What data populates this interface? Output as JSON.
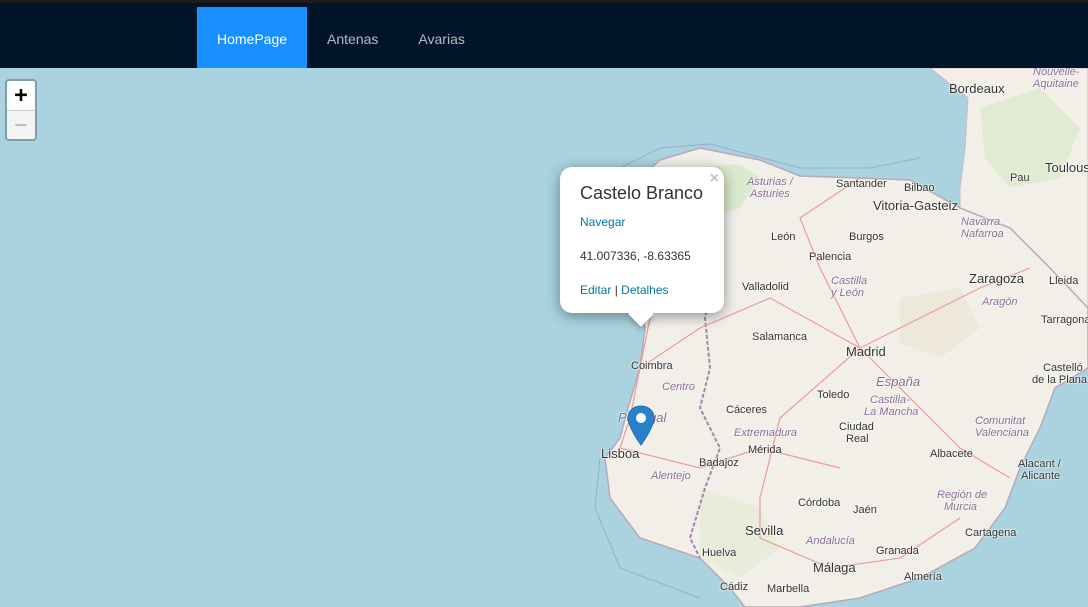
{
  "nav": {
    "items": [
      {
        "label": "HomePage"
      },
      {
        "label": "Antenas"
      },
      {
        "label": "Avarias"
      }
    ]
  },
  "map": {
    "zoom_in": "+",
    "zoom_out": "−",
    "labels": {
      "bordeaux": "Bordeaux",
      "nouvelle_aquitaine_1": "Nouvelle-",
      "nouvelle_aquitaine_2": "Aquitaine",
      "toulouse": "Toulous",
      "pau": "Pau",
      "asturias": "Asturias /",
      "asturies": "Asturies",
      "santander": "Santander",
      "bilbao": "Bilbao",
      "vitoria": "Vitoria-Gasteiz",
      "navarra": "Navarra",
      "nafarroa": "Nafarroa",
      "leon": "León",
      "burgos": "Burgos",
      "palencia": "Palencia",
      "castilla_leon_1": "Castilla",
      "castilla_leon_2": "y León",
      "valladolid": "Valladolid",
      "zaragoza": "Zaragoza",
      "aragon": "Aragón",
      "lleida": "Lleida",
      "tarragona": "Tarragona",
      "salamanca": "Salamanca",
      "madrid": "Madrid",
      "espana": "España",
      "coimbra": "Coimbra",
      "centro": "Centro",
      "portugal": "Portugal",
      "caceres": "Cáceres",
      "toledo": "Toledo",
      "castilla_mancha_1": "Castilla-",
      "castilla_mancha_2": "La Mancha",
      "castello_1": "Castelló",
      "castello_2": "de la Plana",
      "comunitat_1": "Comunitat",
      "comunitat_2": "Valenciana",
      "lisboa": "Lisboa",
      "extremadura": "Extremadura",
      "ciudad_real_1": "Ciudad",
      "ciudad_real_2": "Real",
      "badajoz": "Badajoz",
      "merida": "Mérida",
      "albacete": "Albacete",
      "alentejo": "Alentejo",
      "alacant_1": "Alacant /",
      "alacant_2": "Alicante",
      "cordoba": "Córdoba",
      "jaen": "Jaén",
      "murcia_1": "Región de",
      "murcia_2": "Murcia",
      "sevilla": "Sevilla",
      "andalucia": "Andalucía",
      "cartagena": "Cartagena",
      "huelva": "Huelva",
      "granada": "Granada",
      "cadiz": "Cádiz",
      "marbella": "Marbella",
      "malaga": "Málaga",
      "almeria": "Almería"
    }
  },
  "popup": {
    "close": "×",
    "title": "Castelo Branco",
    "navigate": "Navegar",
    "coords": "41.007336, -8.63365",
    "edit": "Editar",
    "separator": " | ",
    "details": "Detalhes"
  },
  "colors": {
    "nav_bg": "#001529",
    "nav_active": "#1890ff",
    "sea": "#aad3df",
    "land": "#f2efe9",
    "marker": "#2a81cb",
    "link": "#0078a8"
  }
}
